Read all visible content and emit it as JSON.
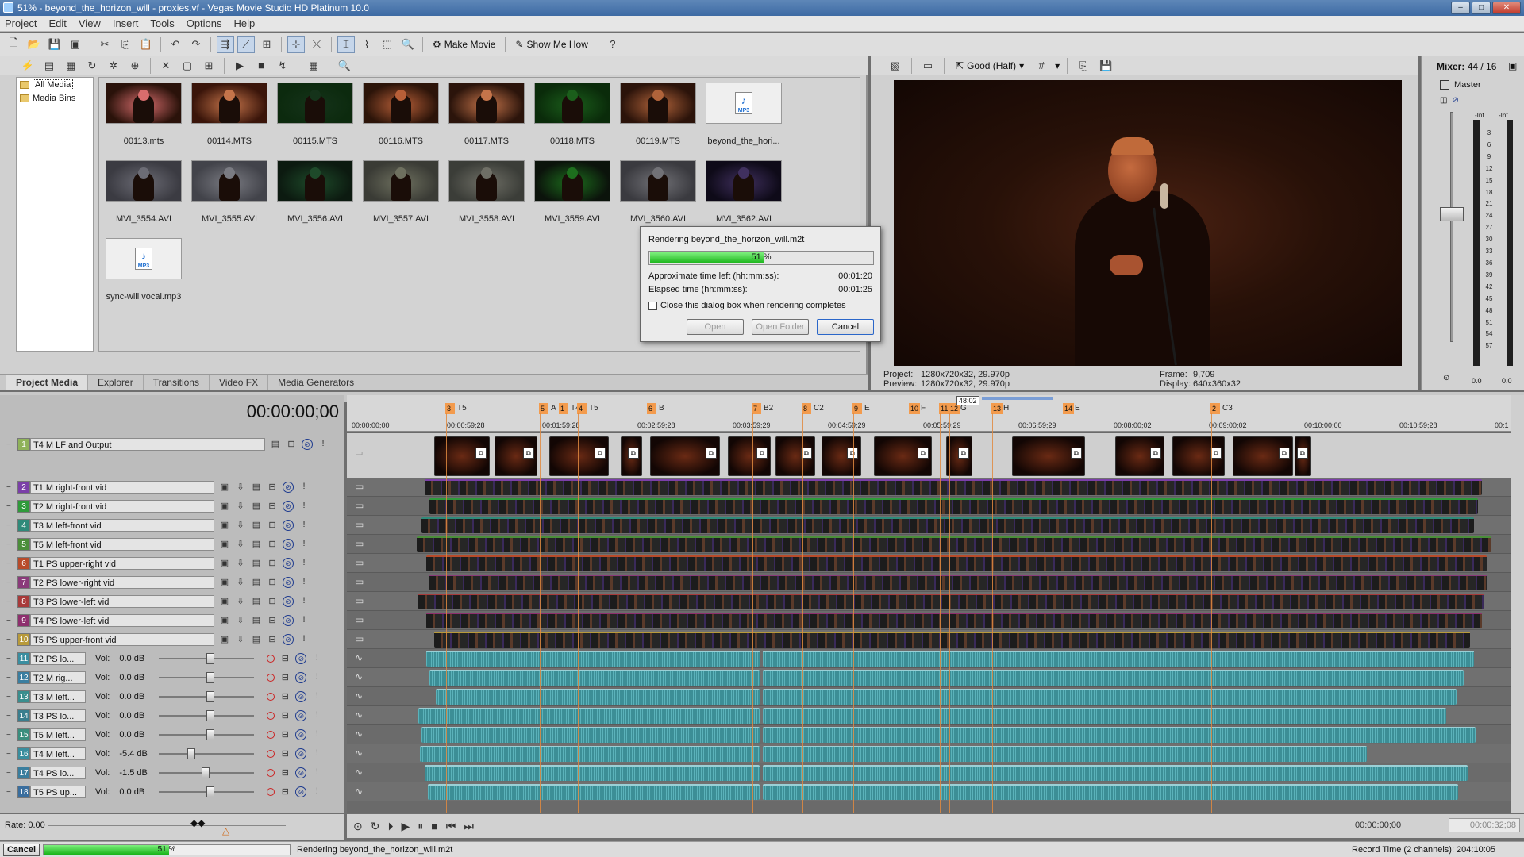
{
  "window": {
    "title": "51% - beyond_the_horizon_will - proxies.vf - Vegas Movie Studio HD Platinum 10.0"
  },
  "menu": [
    "Project",
    "Edit",
    "View",
    "Insert",
    "Tools",
    "Options",
    "Help"
  ],
  "toolbar": {
    "make_movie": "Make Movie",
    "show_me_how": "Show Me How"
  },
  "media": {
    "tree": [
      "All Media",
      "Media Bins"
    ],
    "items": [
      {
        "name": "00113.mts",
        "kind": "video",
        "tint": "#2a120a",
        "face": "#d86d6d"
      },
      {
        "name": "00114.MTS",
        "kind": "video",
        "tint": "#3a150a",
        "face": "#c5744a"
      },
      {
        "name": "00115.MTS",
        "kind": "video",
        "tint": "#0c2a0e",
        "face": "#15331a"
      },
      {
        "name": "00116.MTS",
        "kind": "video",
        "tint": "#2c1409",
        "face": "#b85f38"
      },
      {
        "name": "00117.MTS",
        "kind": "video",
        "tint": "#2b140b",
        "face": "#c5744a"
      },
      {
        "name": "00118.MTS",
        "kind": "video",
        "tint": "#0a2b0a",
        "face": "#1b5e1b"
      },
      {
        "name": "00119.MTS",
        "kind": "video",
        "tint": "#2b130a",
        "face": "#b0633a"
      },
      {
        "name": "beyond_the_hori...",
        "kind": "audio"
      },
      {
        "name": "MVI_3554.AVI",
        "kind": "video",
        "tint": "#3b3b42",
        "face": "#6c6c75"
      },
      {
        "name": "MVI_3555.AVI",
        "kind": "video",
        "tint": "#42434a",
        "face": "#7a7b82"
      },
      {
        "name": "MVI_3556.AVI",
        "kind": "video",
        "tint": "#0c1a10",
        "face": "#1e4a2a"
      },
      {
        "name": "MVI_3557.AVI",
        "kind": "video",
        "tint": "#3a3b35",
        "face": "#6e705f"
      },
      {
        "name": "MVI_3558.AVI",
        "kind": "video",
        "tint": "#3b3d38",
        "face": "#6f6f66"
      },
      {
        "name": "MVI_3559.AVI",
        "kind": "video",
        "tint": "#0b130b",
        "face": "#1d6e1d"
      },
      {
        "name": "MVI_3560.AVI",
        "kind": "video",
        "tint": "#3a3a3f",
        "face": "#717176"
      },
      {
        "name": "MVI_3562.AVI",
        "kind": "video",
        "tint": "#0e0a18",
        "face": "#40305e"
      },
      {
        "name": "sync-will vocal.mp3",
        "kind": "audio"
      }
    ],
    "tabs": [
      "Project Media",
      "Explorer",
      "Transitions",
      "Video FX",
      "Media Generators"
    ],
    "active_tab": "Project Media"
  },
  "preview": {
    "quality": "Good (Half)",
    "project_label": "Project:",
    "project": "1280x720x32, 29.970p",
    "preview_label": "Preview:",
    "preview_res": "1280x720x32, 29.970p",
    "frame_label": "Frame:",
    "frame": "9,709",
    "display_label": "Display:",
    "display": "640x360x32"
  },
  "mixer": {
    "title": "Mixer:",
    "count": "44 / 16",
    "master": "Master",
    "inf_left": "-Inf.",
    "inf_right": "-Inf.",
    "scale": [
      "3",
      "6",
      "9",
      "12",
      "15",
      "18",
      "21",
      "24",
      "27",
      "30",
      "33",
      "36",
      "39",
      "42",
      "45",
      "48",
      "51",
      "54",
      "57"
    ],
    "readout_left": "0.0",
    "readout_right": "0.0",
    "fader_level": "0.0"
  },
  "render_dialog": {
    "title": "Rendering beyond_the_horizon_will.m2t",
    "progress_label": "51 %",
    "progress": 0.51,
    "time_left_label": "Approximate time left (hh:mm:ss):",
    "time_left": "00:01:20",
    "elapsed_label": "Elapsed time (hh:mm:ss):",
    "elapsed": "00:01:25",
    "close_checkbox": "Close this dialog box when rendering completes",
    "close_checked": false,
    "buttons": {
      "open": "Open",
      "open_folder": "Open Folder",
      "cancel": "Cancel"
    }
  },
  "timeline": {
    "timecode": "00:00:00;00",
    "ruler_ticks": [
      "00:00:00;00",
      "00:00:59;28",
      "00:01:59;28",
      "00:02:59;28",
      "00:03:59;29",
      "00:04:59;29",
      "00:05:59;29",
      "00:06:59;29",
      "00:08:00;02",
      "00:09:00;02",
      "00:10:00;00",
      "00:10:59;28",
      "00:1"
    ],
    "markers": [
      {
        "n": "3",
        "label": "T5"
      },
      {
        "n": "5",
        "label": "A"
      },
      {
        "n": "1",
        "label": "T4"
      },
      {
        "n": "4",
        "label": "T5"
      },
      {
        "n": "6",
        "label": "B"
      },
      {
        "n": "7",
        "label": "B2"
      },
      {
        "n": "8",
        "label": "C2"
      },
      {
        "n": "9",
        "label": "E"
      },
      {
        "n": "10",
        "label": "F"
      },
      {
        "n": "11",
        "label": ""
      },
      {
        "n": "12",
        "label": "G"
      },
      {
        "n": "13",
        "label": "H"
      },
      {
        "n": "14",
        "label": "E"
      },
      {
        "n": "2",
        "label": "C3"
      }
    ],
    "region_label": "48:02",
    "tracks": [
      {
        "n": "1",
        "name": "T4 M LF and Output",
        "kind": "comp",
        "color": "#8fb25a"
      },
      {
        "n": "2",
        "name": "T1 M right-front vid",
        "kind": "video",
        "color": "#7b3fa8"
      },
      {
        "n": "3",
        "name": "T2 M right-front vid",
        "kind": "video",
        "color": "#2f9a3a"
      },
      {
        "n": "4",
        "name": "T3 M left-front vid",
        "kind": "video",
        "color": "#2f8a7a"
      },
      {
        "n": "5",
        "name": "T5 M left-front vid",
        "kind": "video",
        "color": "#4b8e3a"
      },
      {
        "n": "6",
        "name": "T1 PS upper-right vid",
        "kind": "video",
        "color": "#b84b2a"
      },
      {
        "n": "7",
        "name": "T2 PS lower-right vid",
        "kind": "video",
        "color": "#8a3a7a"
      },
      {
        "n": "8",
        "name": "T3 PS lower-left vid",
        "kind": "video",
        "color": "#a83a3a"
      },
      {
        "n": "9",
        "name": "T4 PS lower-left vid",
        "kind": "video",
        "color": "#8e2f6e"
      },
      {
        "n": "10",
        "name": "T5 PS upper-front vid",
        "kind": "video",
        "color": "#b89a3a"
      },
      {
        "n": "11",
        "name": "T2 PS lo...",
        "kind": "audio",
        "vol": "0.0 dB",
        "level": 0.5,
        "color": "#3a8ea0"
      },
      {
        "n": "12",
        "name": "T2 M rig...",
        "kind": "audio",
        "vol": "0.0 dB",
        "level": 0.5,
        "color": "#3a7ea0"
      },
      {
        "n": "13",
        "name": "T3 M left...",
        "kind": "audio",
        "vol": "0.0 dB",
        "level": 0.5,
        "color": "#3a8e8e"
      },
      {
        "n": "14",
        "name": "T3 PS lo...",
        "kind": "audio",
        "vol": "0.0 dB",
        "level": 0.5,
        "color": "#3a7e8e"
      },
      {
        "n": "15",
        "name": "T5 M left...",
        "kind": "audio",
        "vol": "0.0 dB",
        "level": 0.5,
        "color": "#3a8e7e"
      },
      {
        "n": "16",
        "name": "T4 M left...",
        "kind": "audio",
        "vol": "-5.4 dB",
        "level": 0.3,
        "color": "#3a8e9e"
      },
      {
        "n": "17",
        "name": "T4 PS lo...",
        "kind": "audio",
        "vol": "-1.5 dB",
        "level": 0.45,
        "color": "#3a7e9e"
      },
      {
        "n": "18",
        "name": "T5 PS up...",
        "kind": "audio",
        "vol": "0.0 dB",
        "level": 0.5,
        "color": "#3a6e9e"
      }
    ],
    "vol_label": "Vol:",
    "rate": "Rate: 0.00",
    "position": "00:00:00;00",
    "end_time": "00:00:32;08"
  },
  "status": {
    "cancel": "Cancel",
    "progress_label": "51 %",
    "progress": 0.51,
    "message": "Rendering beyond_the_horizon_will.m2t",
    "record_time": "Record Time (2 channels): 204:10:05"
  }
}
